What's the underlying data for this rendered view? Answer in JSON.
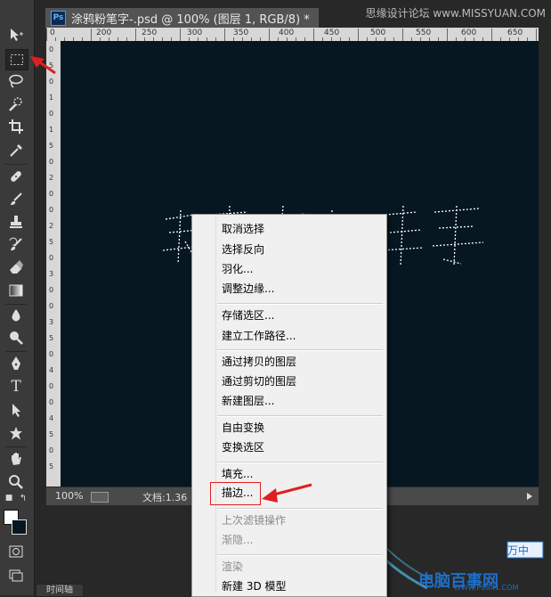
{
  "document": {
    "tab_title": "涂鸦粉笔字-.psd @ 100% (图层 1, RGB/8) *",
    "app_badge": "Ps"
  },
  "watermark_top": "思缘设计论坛 www.MISSYUAN.COM",
  "ruler": {
    "top_labels": [
      "0",
      "200",
      "250",
      "300",
      "350",
      "400",
      "450",
      "500",
      "550",
      "600",
      "650"
    ],
    "left_labels": [
      "0",
      "5",
      "0",
      "1",
      "0",
      "1",
      "5",
      "0",
      "2",
      "0",
      "0",
      "2",
      "5",
      "0",
      "3",
      "0",
      "0",
      "3",
      "5",
      "0",
      "4",
      "0",
      "0",
      "4",
      "5",
      "0",
      "5"
    ]
  },
  "status": {
    "zoom": "100%",
    "doc_info": "文档:1.36"
  },
  "timeline_tab": "时间轴",
  "context_menu": {
    "groups": [
      [
        "取消选择",
        "选择反向",
        "羽化...",
        "调整边缘..."
      ],
      [
        "存储选区...",
        "建立工作路径..."
      ],
      [
        "通过拷贝的图层",
        "通过剪切的图层",
        "新建图层..."
      ],
      [
        "自由变换",
        "变换选区"
      ],
      [
        "填充...",
        "描边..."
      ],
      [
        "上次滤镜操作",
        "渐隐..."
      ],
      [
        "渲染",
        "新建 3D 模型"
      ]
    ],
    "disabled": [
      "上次滤镜操作",
      "渐隐...",
      "渲染"
    ]
  },
  "colors": {
    "canvas": "#061722",
    "annotation": "#e02020",
    "watermark": "#1e6fc8"
  },
  "watermark_bottom": {
    "name": "电脑百事网",
    "url": "WWW.PC841.COM"
  },
  "icons": [
    "move-icon",
    "marquee-icon",
    "lasso-icon",
    "quick-select-icon",
    "crop-icon",
    "eyedropper-icon",
    "healing-icon",
    "brush-icon",
    "stamp-icon",
    "history-brush-icon",
    "eraser-icon",
    "gradient-icon",
    "blur-icon",
    "dodge-icon",
    "pen-icon",
    "type-icon",
    "path-select-icon",
    "shape-icon",
    "hand-icon",
    "zoom-icon"
  ]
}
